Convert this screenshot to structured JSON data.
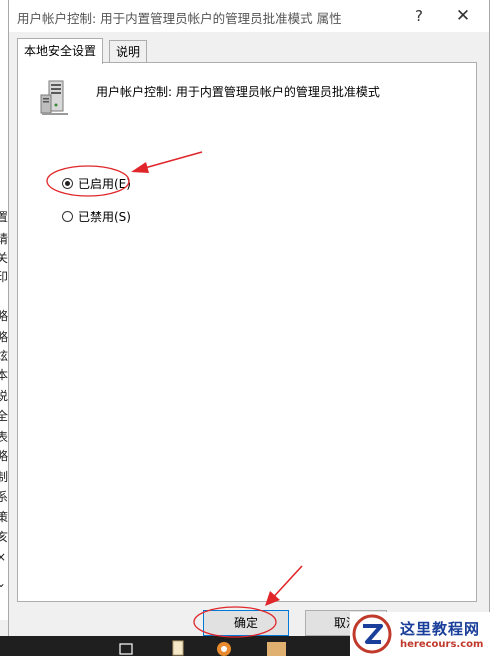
{
  "dialog": {
    "title": "用户帐户控制: 用于内置管理员帐户的管理员批准模式 属性",
    "help_label": "?",
    "close_label": "✕"
  },
  "tabs": [
    {
      "label": "本地安全设置",
      "active": true
    },
    {
      "label": "说明",
      "active": false
    }
  ],
  "policy": {
    "icon": "server-icon",
    "title": "用户帐户控制: 用于内置管理员帐户的管理员批准模式"
  },
  "options": [
    {
      "label": "已启用(E)",
      "selected": true
    },
    {
      "label": "已禁用(S)",
      "selected": false
    }
  ],
  "buttons": {
    "ok": "确定",
    "cancel": "取消"
  },
  "background_left_chars": [
    "置",
    "请",
    "关",
    "印",
    "略",
    "略",
    "炫",
    "本",
    "说",
    "全",
    "表",
    "略",
    "制",
    "系",
    "策",
    "亥",
    "×",
    "⌄"
  ],
  "watermark": {
    "name": "这里教程网",
    "url": "herecours.com"
  },
  "colors": {
    "annotation": "#e0262a",
    "ok_border": "#0078d7",
    "watermark_blue": "#1a3f9a"
  }
}
